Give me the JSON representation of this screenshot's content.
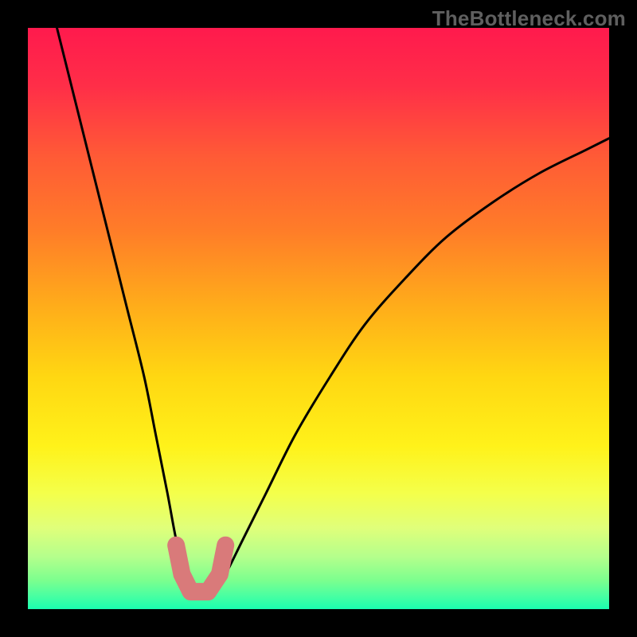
{
  "watermark": "TheBottleneck.com",
  "colors": {
    "frame": "#000000",
    "curve": "#000000",
    "marker": "#d97a7a",
    "gradient_stops": [
      {
        "offset": 0.0,
        "color": "#ff1a4d"
      },
      {
        "offset": 0.1,
        "color": "#ff2e48"
      },
      {
        "offset": 0.22,
        "color": "#ff5a36"
      },
      {
        "offset": 0.35,
        "color": "#ff7d28"
      },
      {
        "offset": 0.48,
        "color": "#ffad1a"
      },
      {
        "offset": 0.6,
        "color": "#ffd712"
      },
      {
        "offset": 0.72,
        "color": "#fff21a"
      },
      {
        "offset": 0.8,
        "color": "#f4ff4a"
      },
      {
        "offset": 0.86,
        "color": "#e0ff7a"
      },
      {
        "offset": 0.91,
        "color": "#b4ff8c"
      },
      {
        "offset": 0.95,
        "color": "#7dff8e"
      },
      {
        "offset": 0.975,
        "color": "#4dffa0"
      },
      {
        "offset": 1.0,
        "color": "#1affb0"
      }
    ]
  },
  "chart_data": {
    "type": "line",
    "title": "",
    "xlabel": "",
    "ylabel": "",
    "xlim": [
      0,
      100
    ],
    "ylim": [
      0,
      100
    ],
    "series": [
      {
        "name": "bottleneck-curve",
        "x": [
          5,
          8,
          11,
          14,
          17,
          20,
          22,
          24,
          25.5,
          27,
          28.5,
          30,
          32,
          34,
          37,
          41,
          46,
          52,
          58,
          65,
          72,
          80,
          88,
          96,
          100
        ],
        "values": [
          100,
          88,
          76,
          64,
          52,
          40,
          30,
          20,
          12,
          6,
          3,
          2,
          3,
          6,
          12,
          20,
          30,
          40,
          49,
          57,
          64,
          70,
          75,
          79,
          81
        ]
      }
    ],
    "markers": [
      {
        "name": "left-u-top",
        "x": 25.5,
        "y": 11
      },
      {
        "name": "left-u-mid",
        "x": 26.5,
        "y": 6
      },
      {
        "name": "u-bottom-l",
        "x": 28.0,
        "y": 3
      },
      {
        "name": "u-bottom-r",
        "x": 31.0,
        "y": 3
      },
      {
        "name": "right-u-mid",
        "x": 33.0,
        "y": 6
      },
      {
        "name": "right-u-top",
        "x": 34.0,
        "y": 11
      }
    ]
  }
}
